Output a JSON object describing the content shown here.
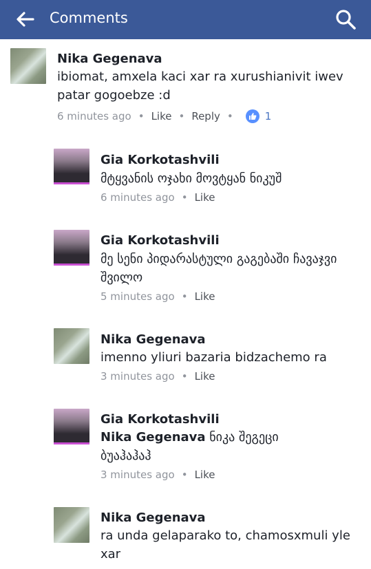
{
  "header": {
    "title": "Comments",
    "back_icon": "arrow-left-icon",
    "search_icon": "search-icon"
  },
  "colors": {
    "header_bg": "#3b5998",
    "like_badge": "#5890ff",
    "meta": "#90949c"
  },
  "comments": [
    {
      "name": "Nika Gegenava",
      "text": "ibiomat, amxela kaci xar ra xurushianivit iwev patar gogoebze :d",
      "time": "6 minutes ago",
      "like": "Like",
      "reply": "Reply",
      "likes": "1"
    },
    {
      "name": "Gia Korkotashvili",
      "text": "მტყვანის ოჯახი მოვტყან ნიკუშ",
      "time": "6 minutes ago",
      "like": "Like"
    },
    {
      "name": "Gia Korkotashvili",
      "text": "მე სენი პიდარასტული გაგებაში ჩავაჯვი შვილო",
      "time": "5 minutes ago",
      "like": "Like"
    },
    {
      "name": "Nika Gegenava",
      "text": "imenno yliuri bazaria bidzachemo ra",
      "time": "3 minutes ago",
      "like": "Like"
    },
    {
      "name": "Gia Korkotashvili",
      "tag": "Nika Gegenava",
      "text": "ნიკა შეგეცი ბუაჰაჰაჰ",
      "time": "3 minutes ago",
      "like": "Like"
    },
    {
      "name": "Nika Gegenava",
      "text": "ra unda gelaparako to, chamosxmuli yle xar"
    }
  ]
}
